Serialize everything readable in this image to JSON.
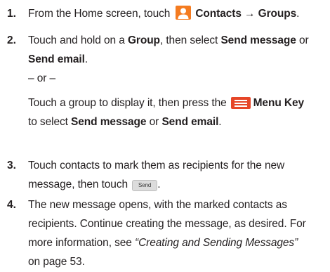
{
  "steps": [
    {
      "number": "1.",
      "from_home": "From the Home screen, touch",
      "contacts_groups": "Contacts → Groups",
      "period": "."
    },
    {
      "number": "2.",
      "line1_pre": "Touch and hold on a",
      "group": "Group",
      "line1_mid": ", then select",
      "send_message": "Send message",
      "or": "or",
      "send_email": "Send email",
      "period": ".",
      "separator": "– or –",
      "alt_pre": "Touch a group to display it, then press the",
      "menu_key": "Menu Key",
      "alt_to_select": "to select",
      "alt_send_message": "Send message",
      "alt_or": "or",
      "alt_send_email": "Send email",
      "alt_period": "."
    },
    {
      "number": "3.",
      "line1": "Touch contacts to mark them as recipients for the new",
      "line2": "message, then touch",
      "send_button": "Send",
      "period": "."
    },
    {
      "number": "4.",
      "line1": "The new message opens, with the marked contacts as",
      "line2": "recipients. Continue creating the message, as desired. For",
      "line3_pre": "more information, see",
      "link": "“Creating and Sending Messages”",
      "line4": "on page 53."
    }
  ],
  "icons": {
    "contacts": "contacts-person-icon",
    "menu": "menu-key-icon",
    "contacts_color": "#f47b20"
  }
}
